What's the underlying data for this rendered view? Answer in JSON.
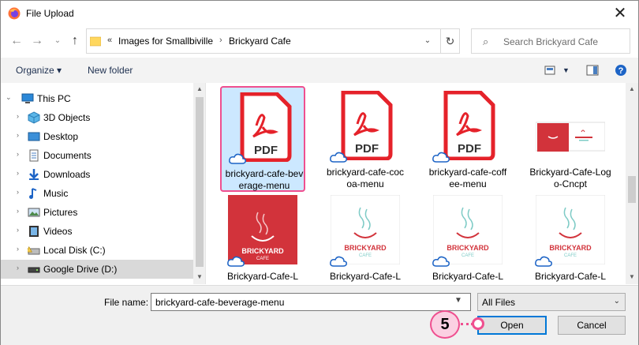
{
  "window": {
    "title": "File Upload"
  },
  "nav": {
    "chevron": "«",
    "breadcrumb": [
      "Images for Smallbiville",
      "Brickyard Cafe"
    ],
    "search_placeholder": "Search Brickyard Cafe"
  },
  "toolbar": {
    "organize": "Organize",
    "new_folder": "New folder"
  },
  "sidebar": {
    "items": [
      {
        "label": "This PC",
        "icon": "computer-icon"
      },
      {
        "label": "3D Objects",
        "icon": "cube-icon"
      },
      {
        "label": "Desktop",
        "icon": "desktop-icon"
      },
      {
        "label": "Documents",
        "icon": "document-icon"
      },
      {
        "label": "Downloads",
        "icon": "download-icon"
      },
      {
        "label": "Music",
        "icon": "music-icon"
      },
      {
        "label": "Pictures",
        "icon": "pictures-icon"
      },
      {
        "label": "Videos",
        "icon": "video-icon"
      },
      {
        "label": "Local Disk (C:)",
        "icon": "disk-icon"
      },
      {
        "label": "Google Drive (D:)",
        "icon": "drive-icon"
      }
    ]
  },
  "files": [
    {
      "name": "brickyard-cafe-beverage-menu",
      "type": "pdf",
      "selected": true
    },
    {
      "name": "brickyard-cafe-cocoa-menu",
      "type": "pdf"
    },
    {
      "name": "brickyard-cafe-coffee-menu",
      "type": "pdf"
    },
    {
      "name": "Brickyard-Cafe-Logo-Cncpt",
      "type": "image"
    },
    {
      "name": "Brickyard-Cafe-L",
      "type": "image-red"
    },
    {
      "name": "Brickyard-Cafe-L",
      "type": "image"
    },
    {
      "name": "Brickyard-Cafe-L",
      "type": "image"
    },
    {
      "name": "Brickyard-Cafe-L",
      "type": "image"
    }
  ],
  "pdf_label": "PDF",
  "logo": {
    "line1": "BRICKYARD",
    "line2": "CAFE"
  },
  "bottom": {
    "file_name_label": "File name:",
    "file_name_value": "brickyard-cafe-beverage-menu",
    "filter_value": "All Files",
    "open_label": "Open",
    "cancel_label": "Cancel"
  },
  "step": {
    "number": "5"
  },
  "colors": {
    "accent": "#ef4f8f",
    "pdf_red": "#e5222a",
    "logo_red": "#d2333b",
    "logo_teal": "#7ecbc6"
  }
}
